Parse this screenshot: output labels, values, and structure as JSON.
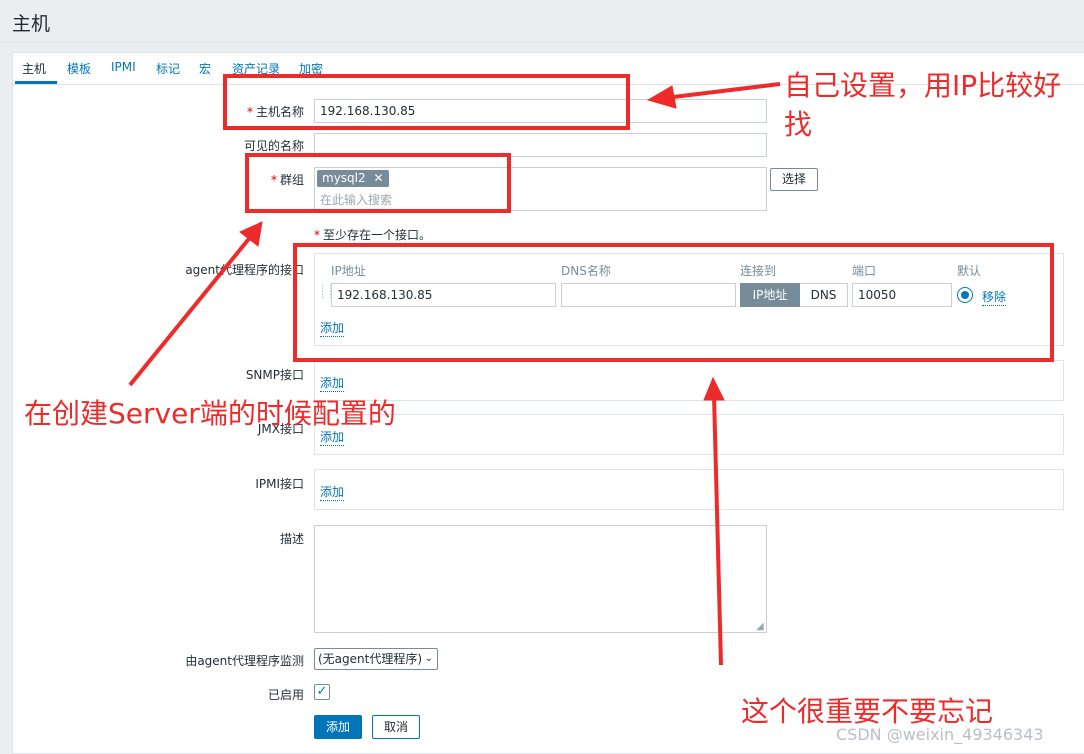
{
  "page": {
    "title": "主机"
  },
  "tabs": [
    {
      "label": "主机"
    },
    {
      "label": "模板"
    },
    {
      "label": "IPMI"
    },
    {
      "label": "标记"
    },
    {
      "label": "宏"
    },
    {
      "label": "资产记录"
    },
    {
      "label": "加密"
    }
  ],
  "form": {
    "host_name": {
      "label": "主机名称",
      "value": "192.168.130.85"
    },
    "visible_name": {
      "label": "可见的名称",
      "value": ""
    },
    "groups": {
      "label": "群组",
      "tag": "mysql2",
      "placeholder": "在此输入搜索",
      "select_label": "选择"
    },
    "interface_required_note": "至少存在一个接口。",
    "agent_interfaces": {
      "label": "agent代理程序的接口",
      "headers": {
        "ip": "IP地址",
        "dns": "DNS名称",
        "connect_to": "连接到",
        "port": "端口",
        "default": "默认"
      },
      "row": {
        "ip": "192.168.130.85",
        "dns": "",
        "connect_ip": "IP地址",
        "connect_dns": "DNS",
        "port": "10050",
        "remove": "移除"
      },
      "add": "添加"
    },
    "snmp": {
      "label": "SNMP接口",
      "add": "添加"
    },
    "jmx": {
      "label": "JMX接口",
      "add": "添加"
    },
    "ipmi": {
      "label": "IPMI接口",
      "add": "添加"
    },
    "description": {
      "label": "描述",
      "value": ""
    },
    "monitored_by": {
      "label": "由agent代理程序监测",
      "value": "(无agent代理程序)"
    },
    "enabled": {
      "label": "已启用",
      "checked": true
    },
    "buttons": {
      "add": "添加",
      "cancel": "取消"
    }
  },
  "annotations": {
    "top_line1": "自己设置，用IP比较好",
    "top_line2": "找",
    "left": "在创建Server端的时候配置的",
    "bottom": "这个很重要不要忘记",
    "color": "#ee2b2b"
  },
  "watermark": "CSDN @weixin_49346343",
  "colors": {
    "accent": "#0275b8",
    "required": "#d40000"
  }
}
